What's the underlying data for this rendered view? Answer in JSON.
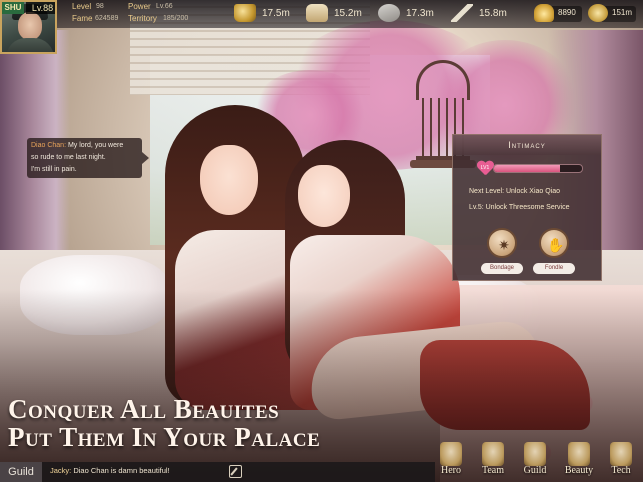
{
  "player": {
    "faction": "SHU",
    "level": "Lv.88",
    "stats": {
      "level_label": "Level",
      "level_value": "98",
      "power_label": "Power",
      "power_value": "Lv.66",
      "fame_label": "Fame",
      "fame_value": "624589",
      "territory_label": "Territory",
      "territory_value": "185/200"
    }
  },
  "resources": {
    "gold": "17.5m",
    "food": "15.2m",
    "troops": "17.3m",
    "weapons": "15.8m",
    "ingots": "8890",
    "coins": "151m"
  },
  "speech": {
    "speaker": "Diao Chan:",
    "line1": " My lord, you were",
    "line2": "so rude to me last night.",
    "line3": "I'm still in pain."
  },
  "intimacy": {
    "title": "Intimacy",
    "heart_label": "LV1",
    "progress": 0.75,
    "next_level": "Next Level:  Unlock Xiao Qiao",
    "lv5": "Lv.5: Unlock Threesome Service",
    "actions": [
      {
        "label": "Bondage",
        "icon": "rope-icon"
      },
      {
        "label": "Fondle",
        "icon": "hands-icon"
      }
    ]
  },
  "banner": {
    "line1": "Conquer All Beauites",
    "line2": "Put Them In Your Palace"
  },
  "nav": [
    {
      "label": "Hero",
      "icon": "hero-icon"
    },
    {
      "label": "Team",
      "icon": "team-icon"
    },
    {
      "label": "Guild",
      "icon": "guild-icon"
    },
    {
      "label": "Beauty",
      "icon": "beauty-icon"
    },
    {
      "label": "Tech",
      "icon": "tech-icon"
    }
  ],
  "chat": {
    "tab": "Guild",
    "name": "Jacky:",
    "message": " Diao Chan is damn beautiful!"
  },
  "colors": {
    "accent_gold": "#e8c98a",
    "intimacy_pink": "#e85d93",
    "speaker_orange": "#e8a35a"
  }
}
